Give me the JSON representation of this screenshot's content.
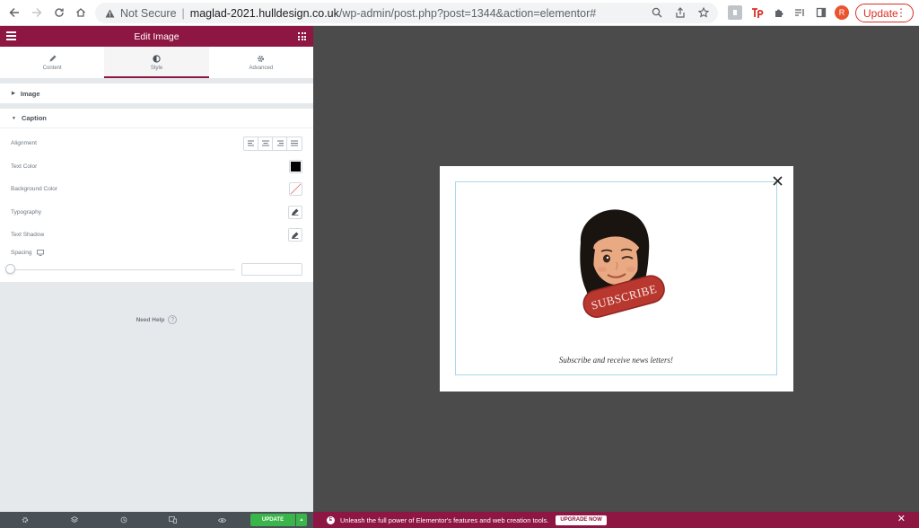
{
  "browser": {
    "not_secure": "Not Secure",
    "url_domain": "maglad-2021.hulldesign.co.uk",
    "url_path": "/wp-admin/post.php?post=1344&action=elementor#",
    "profile_initial": "R",
    "update_label": "Update"
  },
  "panel": {
    "title": "Edit Image",
    "tabs": [
      {
        "label": "Content",
        "icon": "pencil-icon"
      },
      {
        "label": "Style",
        "icon": "half-circle-icon"
      },
      {
        "label": "Advanced",
        "icon": "gear-icon"
      }
    ],
    "sections": {
      "image": "Image",
      "caption": "Caption"
    },
    "controls": {
      "alignment": "Alignment",
      "text_color": "Text Color",
      "background_color": "Background Color",
      "typography": "Typography",
      "text_shadow": "Text Shadow",
      "spacing": "Spacing"
    },
    "colors": {
      "text_color_value": "#000000",
      "accent": "#8e1642"
    },
    "need_help": "Need Help"
  },
  "footer": {
    "update_label": "UPDATE"
  },
  "preview": {
    "sticker_text": "SUBSCRIBE",
    "caption": "Subscribe and receive news letters!"
  },
  "promo": {
    "text": "Unleash the full power of Elementor's features and web creation tools.",
    "button": "UPGRADE NOW"
  }
}
